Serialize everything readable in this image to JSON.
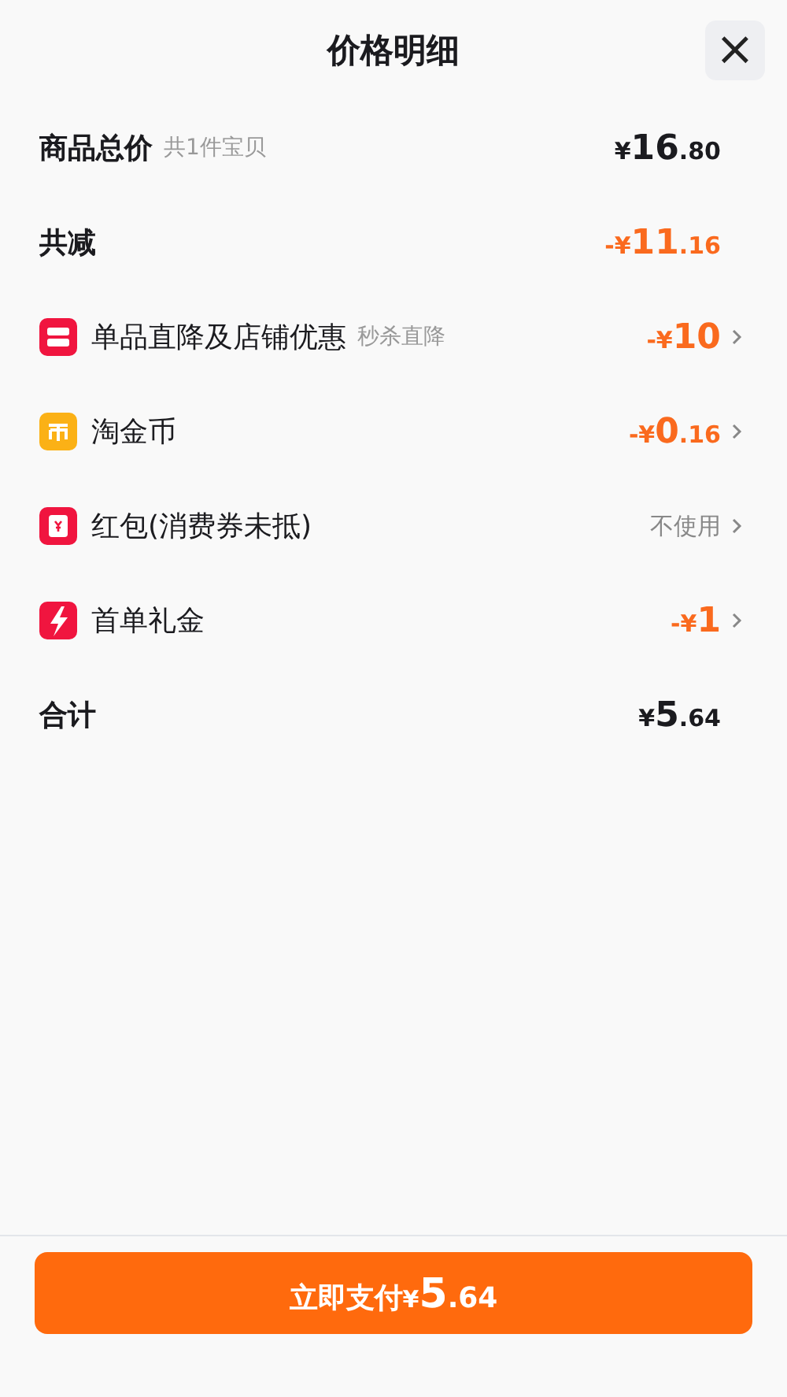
{
  "sheet": {
    "title": "价格明细",
    "close": "×"
  },
  "rows": [
    {
      "kind": "main",
      "label": "商品总价",
      "note": "共1件宝贝",
      "value": "¥16.80",
      "accent": false,
      "chevron": false
    },
    {
      "kind": "main",
      "label": "共减",
      "value": "-¥11.16",
      "accent": true,
      "chevron": false
    },
    {
      "kind": "shop",
      "color": "#f0153f",
      "label": "单品直降及店铺优惠",
      "note": "秒杀直降",
      "value": "-¥10",
      "accent": true,
      "chevron": true
    },
    {
      "kind": "coin",
      "color": "#fbb116",
      "label": "淘金币",
      "value": "-¥0.16",
      "accent": true,
      "chevron": true
    },
    {
      "kind": "envelope",
      "color": "#f0153f",
      "label": "红包(消费券未抵)",
      "value": "不使用",
      "accent": false,
      "muted": true,
      "chevron": true
    },
    {
      "kind": "bolt",
      "color": "#f0153f",
      "label": "首单礼金",
      "value": "-¥1",
      "accent": true,
      "chevron": true
    },
    {
      "kind": "main",
      "label": "合计",
      "value": "¥5.64",
      "accent": false,
      "chevron": false
    }
  ],
  "pay_button": {
    "label": "立即支付",
    "value": "¥5.64"
  }
}
